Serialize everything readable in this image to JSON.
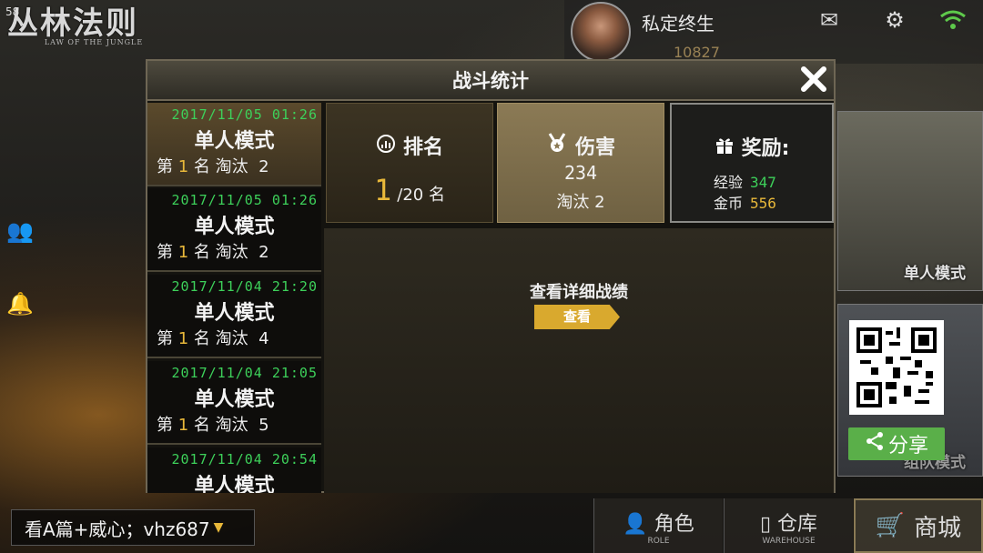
{
  "fps": "58",
  "logo": {
    "title": "丛林法则",
    "subtitle": "LAW OF THE JUNGLE"
  },
  "profile": {
    "name": "私定终生",
    "coins": "10827"
  },
  "icons": {
    "mail": "mail-icon",
    "settings": "gear-icon",
    "wifi": "wifi-icon"
  },
  "modal": {
    "title": "战斗统计",
    "close": "✕",
    "records": [
      {
        "date": "2017/11/05 01:26",
        "mode": "单人模式",
        "prefix": "第 ",
        "rank": "1",
        "mid": " 名 淘汰  ",
        "kills": "2"
      },
      {
        "date": "2017/11/05 01:26",
        "mode": "单人模式",
        "prefix": "第 ",
        "rank": "1",
        "mid": " 名 淘汰  ",
        "kills": "2"
      },
      {
        "date": "2017/11/04 21:20",
        "mode": "单人模式",
        "prefix": "第 ",
        "rank": "1",
        "mid": " 名 淘汰  ",
        "kills": "4"
      },
      {
        "date": "2017/11/04 21:05",
        "mode": "单人模式",
        "prefix": "第 ",
        "rank": "1",
        "mid": " 名 淘汰  ",
        "kills": "5"
      },
      {
        "date": "2017/11/04 20:54",
        "mode": "单人模式",
        "prefix": "",
        "rank": "",
        "mid": "",
        "kills": ""
      }
    ],
    "rank_card": {
      "label": "排名",
      "value": "1",
      "total": "/20 名"
    },
    "damage_card": {
      "label": "伤害",
      "value": "234",
      "kills": "淘汰  2"
    },
    "reward_card": {
      "label": "奖励:",
      "exp_label": "经验",
      "exp": "347",
      "gold_label": "金币",
      "gold": "556"
    },
    "detail": {
      "text": "查看详细战绩",
      "button": "查看"
    }
  },
  "right": {
    "solo_mode": "单人模式",
    "team_mode": "组队模式",
    "share": "分享"
  },
  "bottom": {
    "promo": "看A篇+威心；vhz687",
    "role": "角色",
    "role_en": "ROLE",
    "warehouse": "仓库",
    "warehouse_en": "WAREHOUSE",
    "store": "商城"
  }
}
